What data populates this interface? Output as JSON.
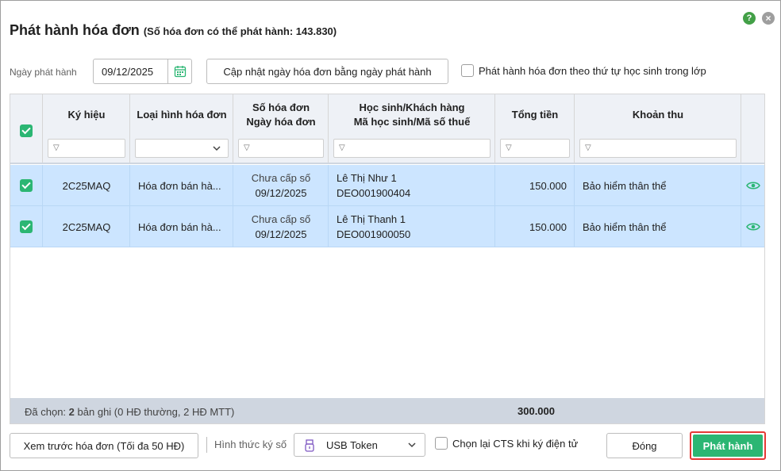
{
  "dialog": {
    "title": "Phát hành hóa đơn",
    "subtitle_prefix": "(Số hóa đơn có thể phát hành:",
    "subtitle_count": "143.830",
    "subtitle_suffix": ")"
  },
  "toolbar": {
    "date_label": "Ngày phát hành",
    "date_value": "09/12/2025",
    "update_button": "Cập nhật ngày hóa đơn bằng ngày phát hành",
    "order_option": "Phát hành hóa đơn theo thứ tự học sinh trong lớp",
    "order_checked": false
  },
  "grid": {
    "headers": {
      "symbol": "Ký hiệu",
      "type": "Loại hình hóa đơn",
      "number_line1": "Số hóa đơn",
      "number_line2": "Ngày hóa đơn",
      "customer_line1": "Học sinh/Khách hàng",
      "customer_line2": "Mã học sinh/Mã số thuế",
      "total": "Tổng tiền",
      "fee": "Khoản thu"
    },
    "rows": [
      {
        "checked": true,
        "symbol": "2C25MAQ",
        "type": "Hóa đơn bán hà...",
        "number": "Chưa cấp số",
        "date": "09/12/2025",
        "name": "Lê Thị Như 1",
        "code": "DEO001900404",
        "total": "150.000",
        "fee": "Bảo hiểm thân thể"
      },
      {
        "checked": true,
        "symbol": "2C25MAQ",
        "type": "Hóa đơn bán hà...",
        "number": "Chưa cấp số",
        "date": "09/12/2025",
        "name": "Lê Thị Thanh 1",
        "code": "DEO001900050",
        "total": "150.000",
        "fee": "Bảo hiểm thân thể"
      }
    ],
    "summary": {
      "prefix": "Đã chọn:",
      "count": "2",
      "suffix": "bản ghi (0 HĐ thường, 2 HĐ MTT)",
      "total": "300.000"
    }
  },
  "footer": {
    "preview_button": "Xem trước hóa đơn (Tối đa 50 HĐ)",
    "sign_label": "Hình thức ký số",
    "sign_value": "USB Token",
    "cts_option": "Chọn lại CTS khi ký điện tử",
    "close_button": "Đóng",
    "issue_button": "Phát hành"
  },
  "colors": {
    "accent": "#2bb673",
    "row_selected": "#cce5ff",
    "highlight_border": "#e53935"
  }
}
